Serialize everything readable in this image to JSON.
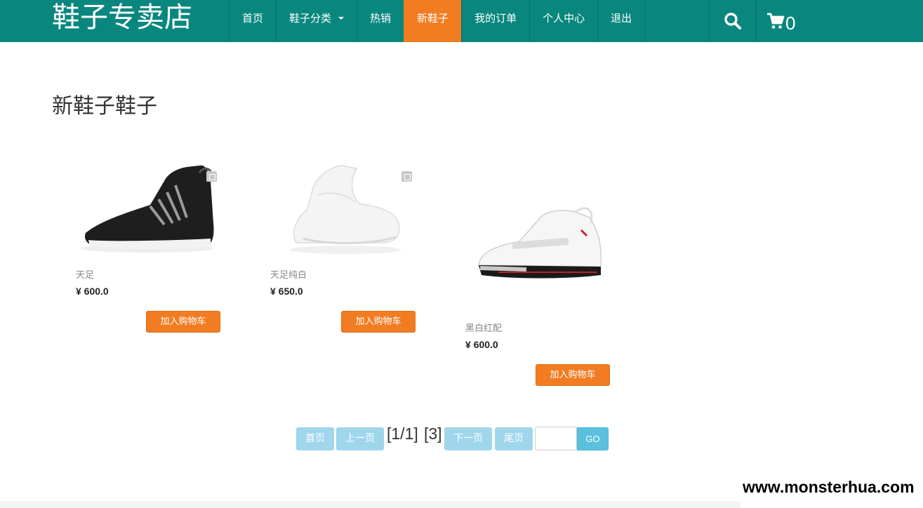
{
  "brand": "鞋子专卖店",
  "nav": {
    "items": [
      {
        "label": "首页"
      },
      {
        "label": "鞋子分类"
      },
      {
        "label": "热销"
      },
      {
        "label": "新鞋子"
      },
      {
        "label": "我的订单"
      },
      {
        "label": "个人中心"
      },
      {
        "label": "退出"
      }
    ],
    "active": "新鞋子",
    "cart_count": "0"
  },
  "page_title": "新鞋子鞋子",
  "products": [
    {
      "name": "天足",
      "price": "¥ 600.0",
      "button": "加入购物车"
    },
    {
      "name": "天足纯白",
      "price": "¥ 650.0",
      "button": "加入购物车"
    },
    {
      "name": "黑白红配",
      "price": "¥ 600.0",
      "button": "加入购物车"
    }
  ],
  "pagination": {
    "first": "首页",
    "prev": "上一页",
    "page_info": "[1/1]",
    "total": "[3]",
    "next": "下一页",
    "last": "尾页",
    "input_value": "",
    "go": "GO"
  },
  "watermark": "www.monsterhua.com",
  "colors": {
    "nav_bg": "#09877e",
    "accent": "#f17c22",
    "pager": "#9fd6ec",
    "go": "#5bc0de"
  }
}
